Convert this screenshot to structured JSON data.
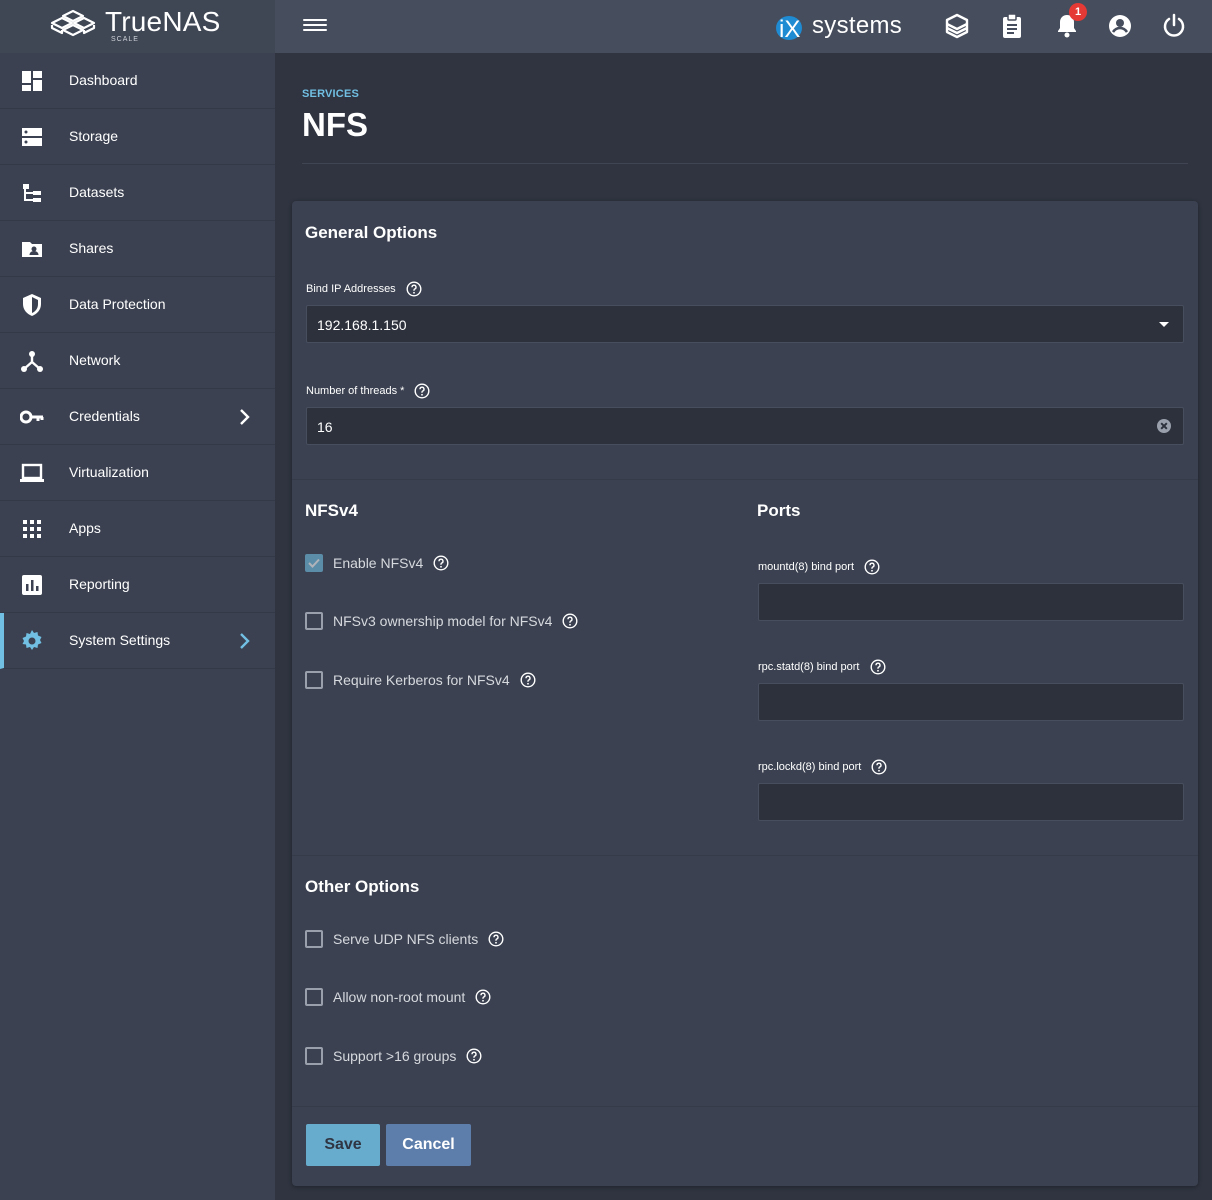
{
  "brand": {
    "name": "TrueNAS",
    "edition": "SCALE"
  },
  "vendor": {
    "logo_text": "systems",
    "logo_mark": "iX"
  },
  "notifications": {
    "count": "1"
  },
  "sidebar": {
    "items": [
      {
        "label": "Dashboard",
        "icon": "dashboard-icon"
      },
      {
        "label": "Storage",
        "icon": "storage-icon"
      },
      {
        "label": "Datasets",
        "icon": "datasets-icon"
      },
      {
        "label": "Shares",
        "icon": "shares-icon"
      },
      {
        "label": "Data Protection",
        "icon": "shield-icon"
      },
      {
        "label": "Network",
        "icon": "network-icon"
      },
      {
        "label": "Credentials",
        "icon": "key-icon"
      },
      {
        "label": "Virtualization",
        "icon": "laptop-icon"
      },
      {
        "label": "Apps",
        "icon": "apps-grid-icon"
      },
      {
        "label": "Reporting",
        "icon": "reporting-icon"
      },
      {
        "label": "System Settings",
        "icon": "gear-icon"
      }
    ],
    "active": "System Settings"
  },
  "header": {
    "breadcrumb": "SERVICES",
    "title": "NFS"
  },
  "general": {
    "title": "General Options",
    "bind_ip_label": "Bind IP Addresses",
    "bind_ip_value": "192.168.1.150",
    "threads_label": "Number of threads *",
    "threads_value": "16"
  },
  "nfsv4": {
    "title": "NFSv4",
    "enable_label": "Enable NFSv4",
    "enable_checked": true,
    "ownership_label": "NFSv3 ownership model for NFSv4",
    "ownership_checked": false,
    "kerberos_label": "Require Kerberos for NFSv4",
    "kerberos_checked": false
  },
  "ports": {
    "title": "Ports",
    "mountd_label": "mountd(8) bind port",
    "mountd_value": "",
    "statd_label": "rpc.statd(8) bind port",
    "statd_value": "",
    "lockd_label": "rpc.lockd(8) bind port",
    "lockd_value": ""
  },
  "other": {
    "title": "Other Options",
    "udp_label": "Serve UDP NFS clients",
    "nonroot_label": "Allow non-root mount",
    "groups_label": "Support >16 groups"
  },
  "actions": {
    "save_label": "Save",
    "cancel_label": "Cancel"
  },
  "colors": {
    "accent": "#71bfe3",
    "cancel": "#5d7eaa",
    "badge": "#e53935"
  }
}
